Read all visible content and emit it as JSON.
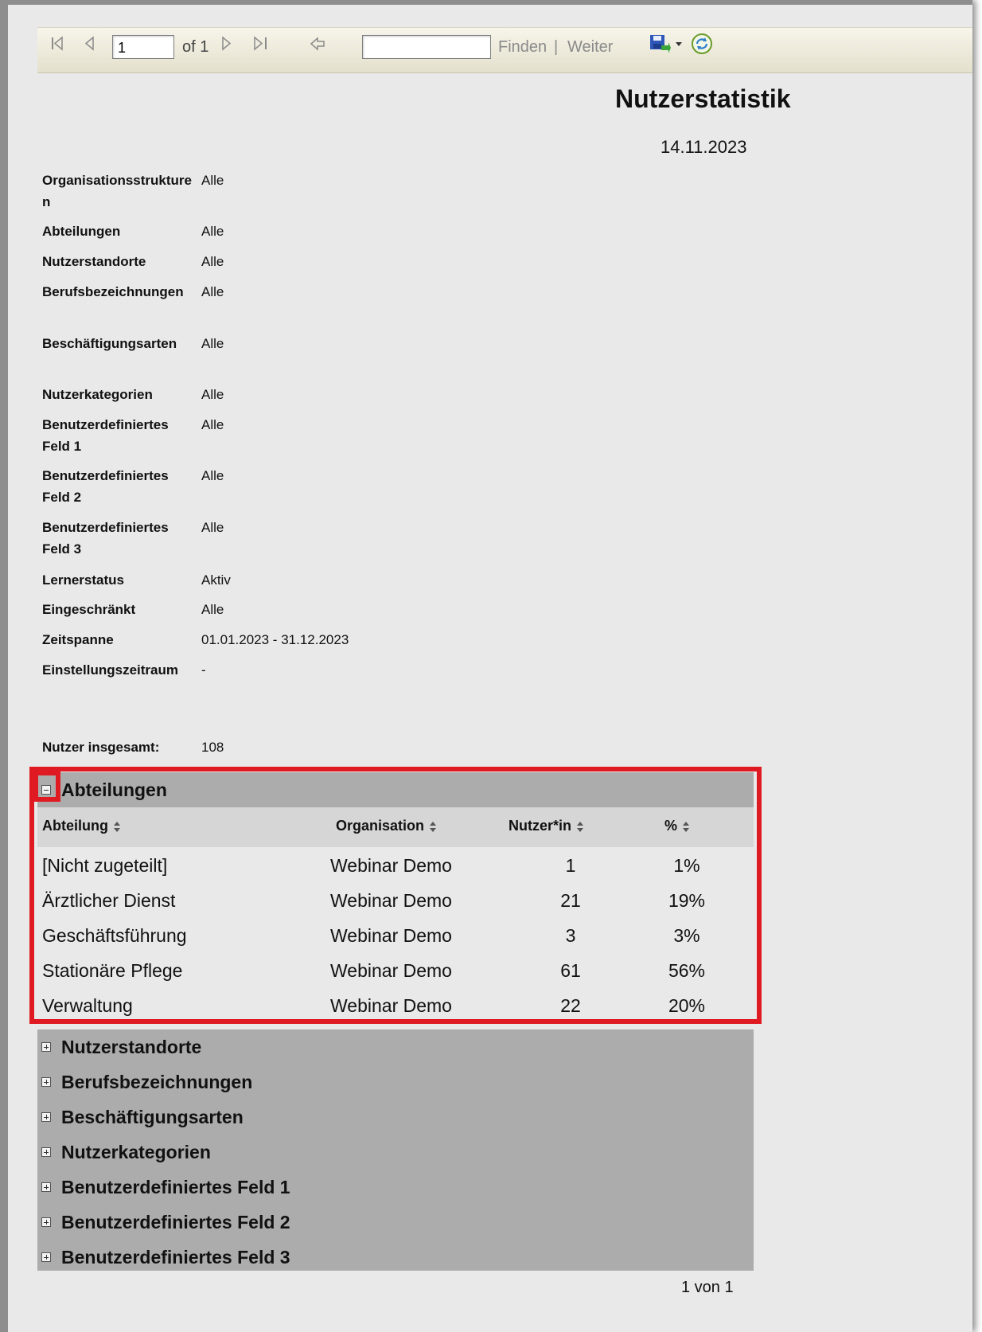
{
  "toolbar": {
    "page_input": "1",
    "of_label": "of 1",
    "search_value": "",
    "find_label": "Finden",
    "separator": "|",
    "next_label": "Weiter"
  },
  "report": {
    "title": "Nutzerstatistik",
    "date": "14.11.2023"
  },
  "parameters": [
    {
      "label": "Organisationsstrukturen",
      "value": "Alle"
    },
    {
      "label": "Abteilungen",
      "value": "Alle"
    },
    {
      "label": "Nutzerstandorte",
      "value": "Alle"
    },
    {
      "label": "Berufsbezeichnungen",
      "value": "Alle"
    },
    {
      "label": "Beschäftigungsarten",
      "value": "Alle"
    },
    {
      "label": "Nutzerkategorien",
      "value": "Alle"
    },
    {
      "label": "Benutzerdefiniertes Feld 1",
      "value": "Alle"
    },
    {
      "label": "Benutzerdefiniertes Feld 2",
      "value": "Alle"
    },
    {
      "label": "Benutzerdefiniertes Feld 3",
      "value": "Alle"
    },
    {
      "label": "Lernerstatus",
      "value": "Aktiv"
    },
    {
      "label": "Eingeschränkt",
      "value": "Alle"
    },
    {
      "label": "Zeitspanne",
      "value": "01.01.2023 - 31.12.2023"
    },
    {
      "label": "Einstellungszeitraum",
      "value": "-"
    }
  ],
  "total": {
    "label": "Nutzer insgesamt:",
    "value": "108"
  },
  "expanded_section": {
    "title": "Abteilungen",
    "columns": [
      "Abteilung",
      "Organisation",
      "Nutzer*in",
      "%"
    ],
    "rows": [
      {
        "abteilung": "[Nicht zugeteilt]",
        "organisation": "Webinar Demo",
        "nutzer": "1",
        "prozent": "1%"
      },
      {
        "abteilung": "Ärztlicher Dienst",
        "organisation": "Webinar Demo",
        "nutzer": "21",
        "prozent": "19%"
      },
      {
        "abteilung": "Geschäftsführung",
        "organisation": "Webinar Demo",
        "nutzer": "3",
        "prozent": "3%"
      },
      {
        "abteilung": "Stationäre Pflege",
        "organisation": "Webinar Demo",
        "nutzer": "61",
        "prozent": "56%"
      },
      {
        "abteilung": "Verwaltung",
        "organisation": "Webinar Demo",
        "nutzer": "22",
        "prozent": "20%"
      }
    ]
  },
  "collapsed_sections": [
    "Nutzerstandorte",
    "Berufsbezeichnungen",
    "Beschäftigungsarten",
    "Nutzerkategorien",
    "Benutzerdefiniertes Feld 1",
    "Benutzerdefiniertes Feld 2",
    "Benutzerdefiniertes Feld 3"
  ],
  "footer": {
    "page_info": "1 von 1"
  },
  "colors": {
    "highlight": "#e01a22",
    "section_bg": "#acacac",
    "header_row_bg": "#d6d6d6",
    "page_bg": "#e9e9e9"
  }
}
